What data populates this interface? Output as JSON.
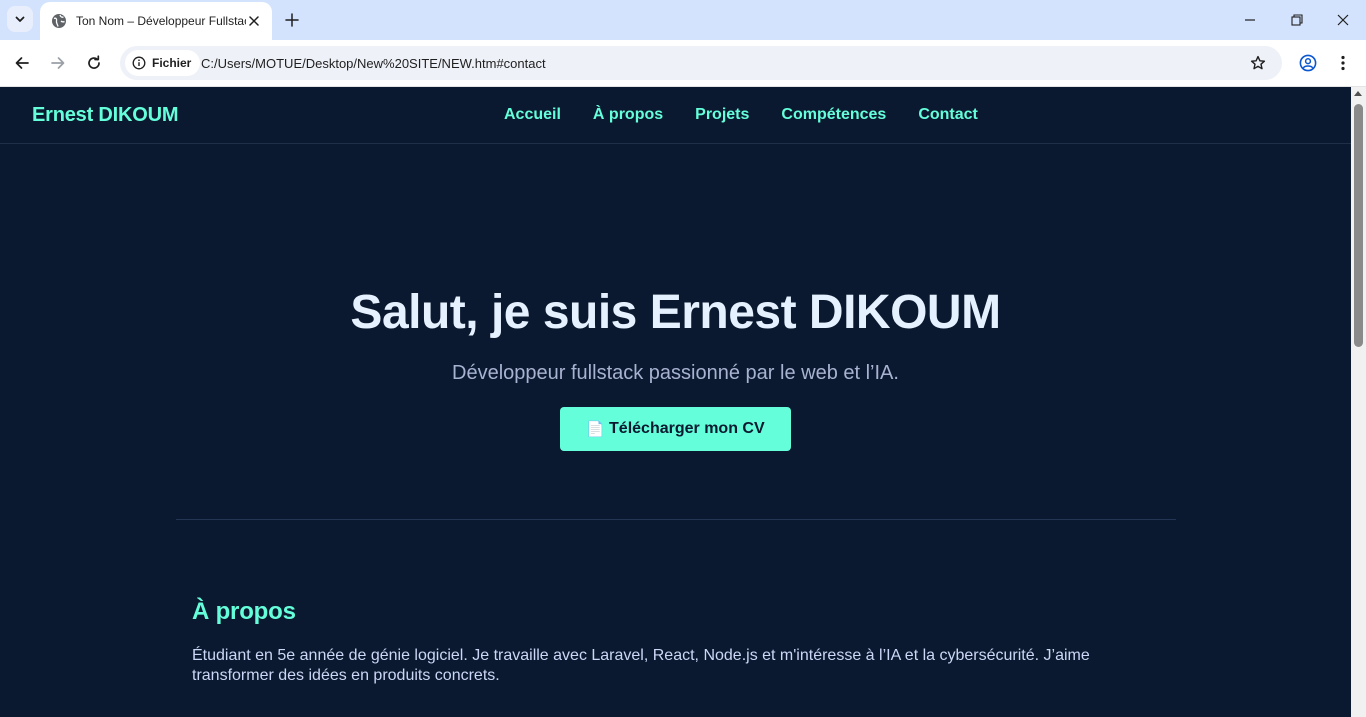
{
  "browser": {
    "tab_title": "Ton Nom – Développeur Fullstack",
    "security_chip": "Fichier",
    "url": "C:/Users/MOTUE/Desktop/New%20SITE/NEW.htm#contact"
  },
  "site": {
    "brand": "Ernest DIKOUM",
    "nav": [
      "Accueil",
      "À propos",
      "Projets",
      "Compétences",
      "Contact"
    ]
  },
  "hero": {
    "title": "Salut, je suis Ernest DIKOUM",
    "subtitle": "Développeur fullstack passionné par le web et l’IA.",
    "cta_icon": "📄",
    "cta_label": "Télécharger mon CV"
  },
  "about": {
    "title": "À propos",
    "text": "Étudiant en 5e année de génie logiciel. Je travaille avec Laravel, React, Node.js et m'intéresse à l’IA et la cybersécurité. J’aime transformer des idées en produits concrets."
  },
  "colors": {
    "page_bg": "#0a192f",
    "accent": "#64ffda",
    "heading": "#e6f1ff",
    "muted": "#a8b2d1"
  }
}
